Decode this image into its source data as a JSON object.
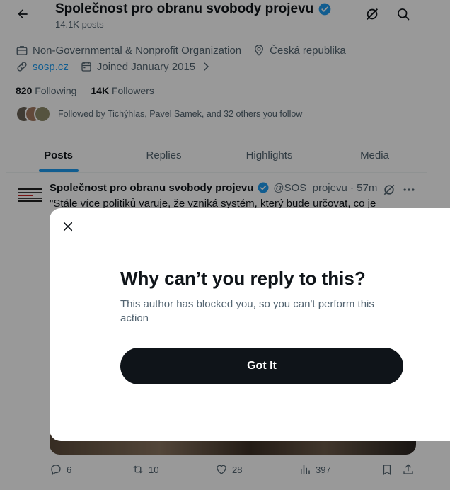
{
  "header": {
    "title": "Společnost pro obranu svobody projevu",
    "posts_count": "14.1K posts"
  },
  "profile": {
    "category": "Non-Governmental & Nonprofit Organization",
    "location": "Česká republika",
    "website": "sosp.cz",
    "joined": "Joined January 2015",
    "following_count": "820",
    "following_label": "Following",
    "followers_count": "14K",
    "followers_label": "Followers",
    "followed_by": "Followed by Tichýhlas, Pavel Samek, and 32 others you follow"
  },
  "tabs": [
    {
      "label": "Posts",
      "active": true
    },
    {
      "label": "Replies",
      "active": false
    },
    {
      "label": "Highlights",
      "active": false
    },
    {
      "label": "Media",
      "active": false
    }
  ],
  "post": {
    "author": "Společnost pro obranu svobody projevu",
    "handle_time": "@SOS_projevu · 57m",
    "text": "\"Stále více politiků varuje, že vzniká systém, který bude určovat, co je",
    "replies": "6",
    "reposts": "10",
    "likes": "28",
    "views": "397"
  },
  "modal": {
    "title": "Why can’t you reply to this?",
    "description": "This author has blocked you, so you can't perform this action",
    "button_label": "Got It"
  },
  "colors": {
    "accent": "#1d9bf0",
    "text_primary": "#0f1419",
    "text_secondary": "#536471",
    "button_bg": "#0f1419"
  }
}
